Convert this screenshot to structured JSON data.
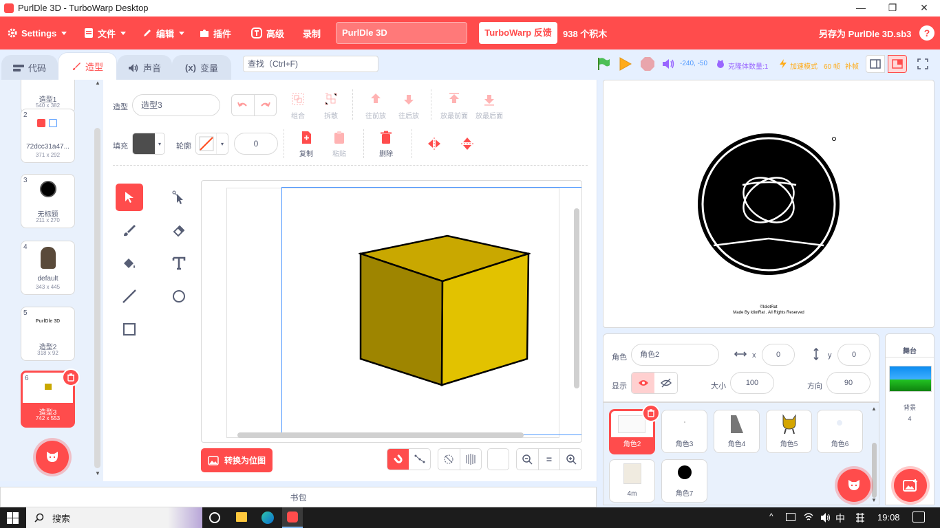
{
  "window": {
    "title": "PurlDle 3D - TurboWarp Desktop",
    "minimize": "—",
    "maximize": "❐",
    "close": "✕"
  },
  "menu": {
    "settings": "Settings",
    "file": "文件",
    "edit": "编辑",
    "addons": "插件",
    "advanced": "高级",
    "record": "录制",
    "project_name": "PurlDle 3D",
    "feedback": "TurboWarp 反馈",
    "block_count": "938 个积木",
    "save_as": "另存为 PurlDle 3D.sb3"
  },
  "tabs": {
    "code": "代码",
    "costumes": "造型",
    "sounds": "声音",
    "variables": "变量",
    "search_placeholder": "查找（Ctrl+F)"
  },
  "stage_controls": {
    "coords": "-240, -50",
    "clone_count": "克隆体数量:1",
    "turbo": "加速模式",
    "fps": "60 帧",
    "interp": "补帧"
  },
  "costumes": [
    {
      "num": "",
      "name": "造型1",
      "size": "540 x 382"
    },
    {
      "num": "2",
      "name": "72dcc31a47...",
      "size": "371 x 292"
    },
    {
      "num": "3",
      "name": "无标题",
      "size": "211 x 270"
    },
    {
      "num": "4",
      "name": "default",
      "size": "343 x 445"
    },
    {
      "num": "5",
      "name": "造型2",
      "size": "318 x 92",
      "thumb_text": "PurlDle 3D"
    },
    {
      "num": "6",
      "name": "造型3",
      "size": "742 x 553"
    }
  ],
  "paint": {
    "costume_label": "造型",
    "costume_name": "造型3",
    "fill_label": "填充",
    "outline_label": "轮廓",
    "outline_width": "0",
    "group": "组合",
    "ungroup": "拆散",
    "forward": "往前放",
    "backward": "往后放",
    "front": "放最前面",
    "back": "放最后面",
    "copy": "复制",
    "paste": "粘贴",
    "delete": "删除",
    "convert_bitmap": "转换为位图",
    "zoom_reset": "="
  },
  "stage_canvas": {
    "credit_line1": "©IdiotRat",
    "credit_line2": "Made By IdiotRat . All Rights Reserved"
  },
  "sprite_info": {
    "sprite_label": "角色",
    "sprite_name": "角色2",
    "x_label": "x",
    "x": "0",
    "y_label": "y",
    "y": "0",
    "show_label": "显示",
    "size_label": "大小",
    "size": "100",
    "direction_label": "方向",
    "direction": "90"
  },
  "sprites": [
    {
      "name": "角色2"
    },
    {
      "name": "角色3"
    },
    {
      "name": "角色4"
    },
    {
      "name": "角色5"
    },
    {
      "name": "角色6"
    },
    {
      "name": "4m"
    },
    {
      "name": "角色7"
    }
  ],
  "stage_panel": {
    "title": "舞台",
    "backdrops_label": "背景",
    "backdrops_count": "4"
  },
  "backpack": "书包",
  "taskbar": {
    "search": "搜索",
    "ime": "中",
    "time": "19:08"
  },
  "colors": {
    "accent": "#ff4c4c",
    "cube_top": "#c9a800",
    "cube_left": "#9e8500",
    "cube_right": "#e2c200"
  }
}
